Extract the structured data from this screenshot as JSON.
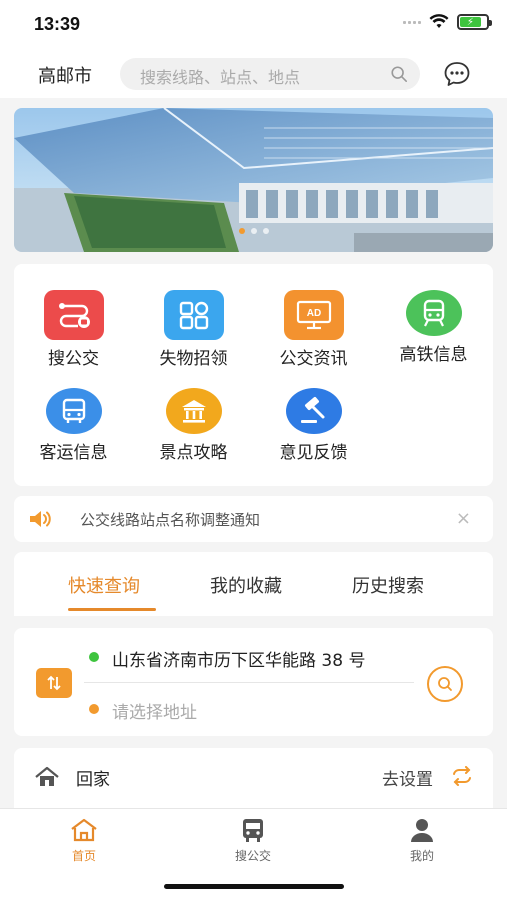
{
  "status_bar": {
    "time": "13:39",
    "battery_percent": 80
  },
  "header": {
    "city": "高邮市",
    "search_placeholder": "搜索线路、站点、地点"
  },
  "banner": {
    "slide_count": 3,
    "active_index": 0
  },
  "menu": {
    "items": [
      {
        "label": "搜公交",
        "icon": "bus-route-icon",
        "color": "#ec4b4b"
      },
      {
        "label": "失物招领",
        "icon": "lost-found-icon",
        "color": "#3ba6ee"
      },
      {
        "label": "公交资讯",
        "icon": "bus-news-icon",
        "color": "#f3922f"
      },
      {
        "label": "高铁信息",
        "icon": "train-icon",
        "color": "#4cc25a"
      },
      {
        "label": "客运信息",
        "icon": "coach-icon",
        "color": "#3b8fe8"
      },
      {
        "label": "景点攻略",
        "icon": "scenic-spot-icon",
        "color": "#f2a81d"
      },
      {
        "label": "意见反馈",
        "icon": "feedback-gavel-icon",
        "color": "#2e7be4"
      }
    ]
  },
  "notice": {
    "text": "公交线路站点名称调整通知",
    "close": "×"
  },
  "query_tabs": {
    "tabs": [
      "快速查询",
      "我的收藏",
      "历史搜索"
    ],
    "active": 0
  },
  "route": {
    "from": "山东省济南市历下区华能路 38 号",
    "to_placeholder": "请选择地址"
  },
  "home": {
    "label": "回家",
    "action": "去设置"
  },
  "tabbar": {
    "items": [
      "首页",
      "搜公交",
      "我的"
    ],
    "active": 0
  },
  "colors": {
    "accent": "#e5892b",
    "green_dot": "#3ec43e"
  }
}
